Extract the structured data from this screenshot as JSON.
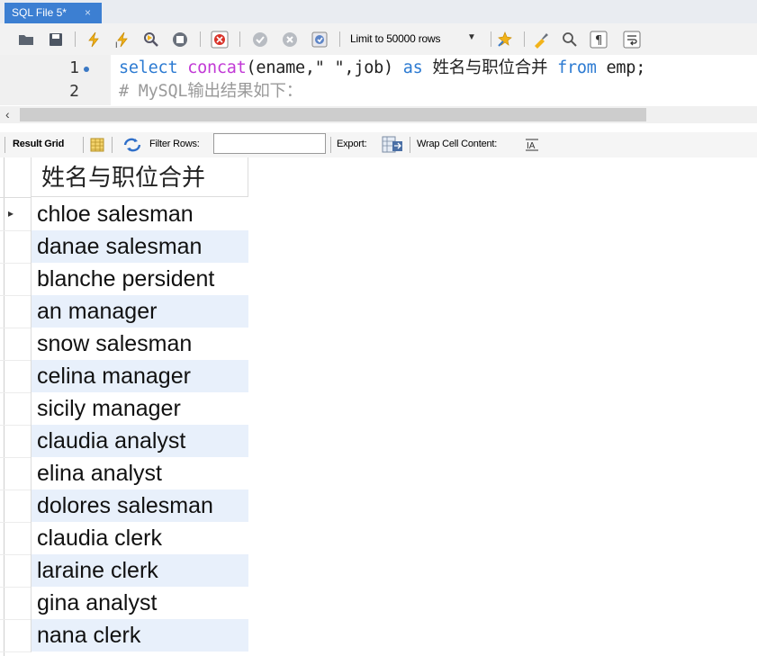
{
  "tab": {
    "label": "SQL File 5*",
    "close": "×"
  },
  "toolbar": {
    "limit_label": "Limit to 50000 rows",
    "icons": [
      "open-folder-icon",
      "save-icon",
      "execute-icon",
      "execute-current-icon",
      "explain-icon",
      "stop-icon",
      "toggle-error-icon",
      "commit-icon",
      "rollback-icon",
      "autocommit-icon",
      "limit-select",
      "beautify-icon",
      "find-icon",
      "invisible-chars-icon",
      "wrap-icon"
    ]
  },
  "editor": {
    "lines": [
      {
        "num": "1",
        "segments": [
          {
            "t": "select ",
            "c": "kw"
          },
          {
            "t": "concat",
            "c": "fn"
          },
          {
            "t": "(ename,\" \",job) ",
            "c": ""
          },
          {
            "t": "as ",
            "c": "kw"
          },
          {
            "t": "姓名与职位合并 ",
            "c": ""
          },
          {
            "t": "from ",
            "c": "kw"
          },
          {
            "t": "emp;",
            "c": ""
          }
        ]
      },
      {
        "num": "2",
        "segments": [
          {
            "t": "# MySQL输出结果如下：",
            "c": "cmt"
          }
        ]
      }
    ]
  },
  "result_toolbar": {
    "result_grid": "Result Grid",
    "filter_rows": "Filter Rows:",
    "export": "Export:",
    "wrap": "Wrap Cell Content:"
  },
  "grid": {
    "column": "姓名与职位合并",
    "rows": [
      "chloe salesman",
      "danae salesman",
      "blanche persident",
      "an manager",
      "snow salesman",
      "celina manager",
      "sicily manager",
      "claudia analyst",
      "elina analyst",
      "dolores salesman",
      "claudia clerk",
      "laraine clerk",
      "gina analyst",
      "nana clerk"
    ]
  }
}
